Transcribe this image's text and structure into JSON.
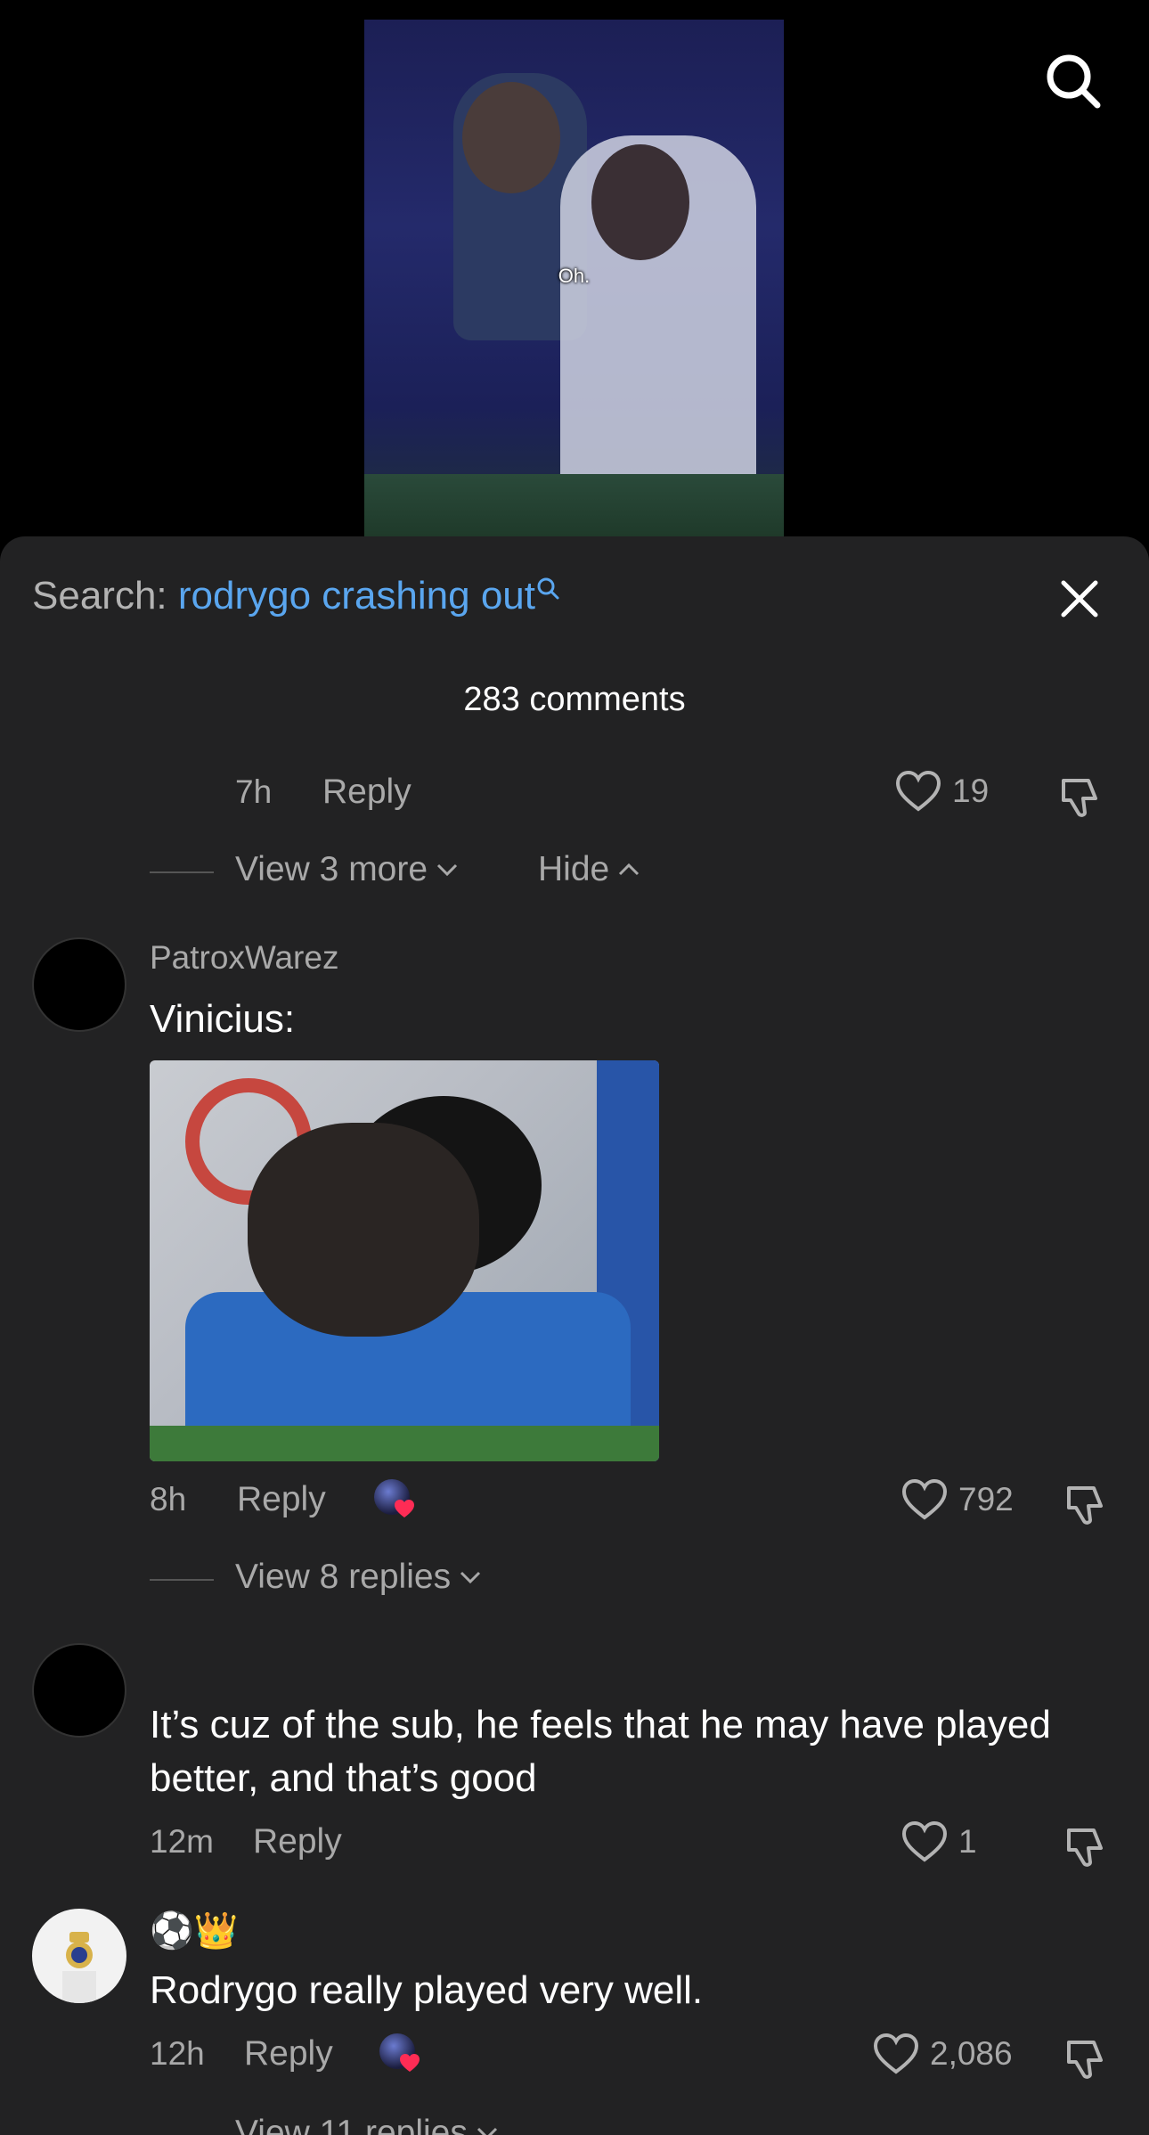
{
  "video": {
    "caption": "Oh."
  },
  "header": {
    "search_prefix": "Search:",
    "search_query": "rodrygo crashing out",
    "comment_count": "283 comments"
  },
  "thread_tail": {
    "time": "7h",
    "reply_label": "Reply",
    "likes": "19",
    "view_more": "View 3 more",
    "hide": "Hide"
  },
  "comments": [
    {
      "username": "PatroxWarez",
      "text": "Vinicius:",
      "time": "8h",
      "reply_label": "Reply",
      "likes": "792",
      "view_replies": "View 8 replies"
    },
    {
      "username": "",
      "text": "It’s cuz of the sub, he feels that he may have played better, and that’s good",
      "time": "12m",
      "reply_label": "Reply",
      "likes": "1"
    },
    {
      "username": "⚽👑",
      "text": "Rodrygo really played very well.",
      "time": "12h",
      "reply_label": "Reply",
      "likes": "2,086",
      "view_replies": "View 11 replies"
    }
  ],
  "colors": {
    "accent": "#5aa6ef",
    "sheet_bg": "#222223",
    "like_red": "#fe2c55"
  }
}
